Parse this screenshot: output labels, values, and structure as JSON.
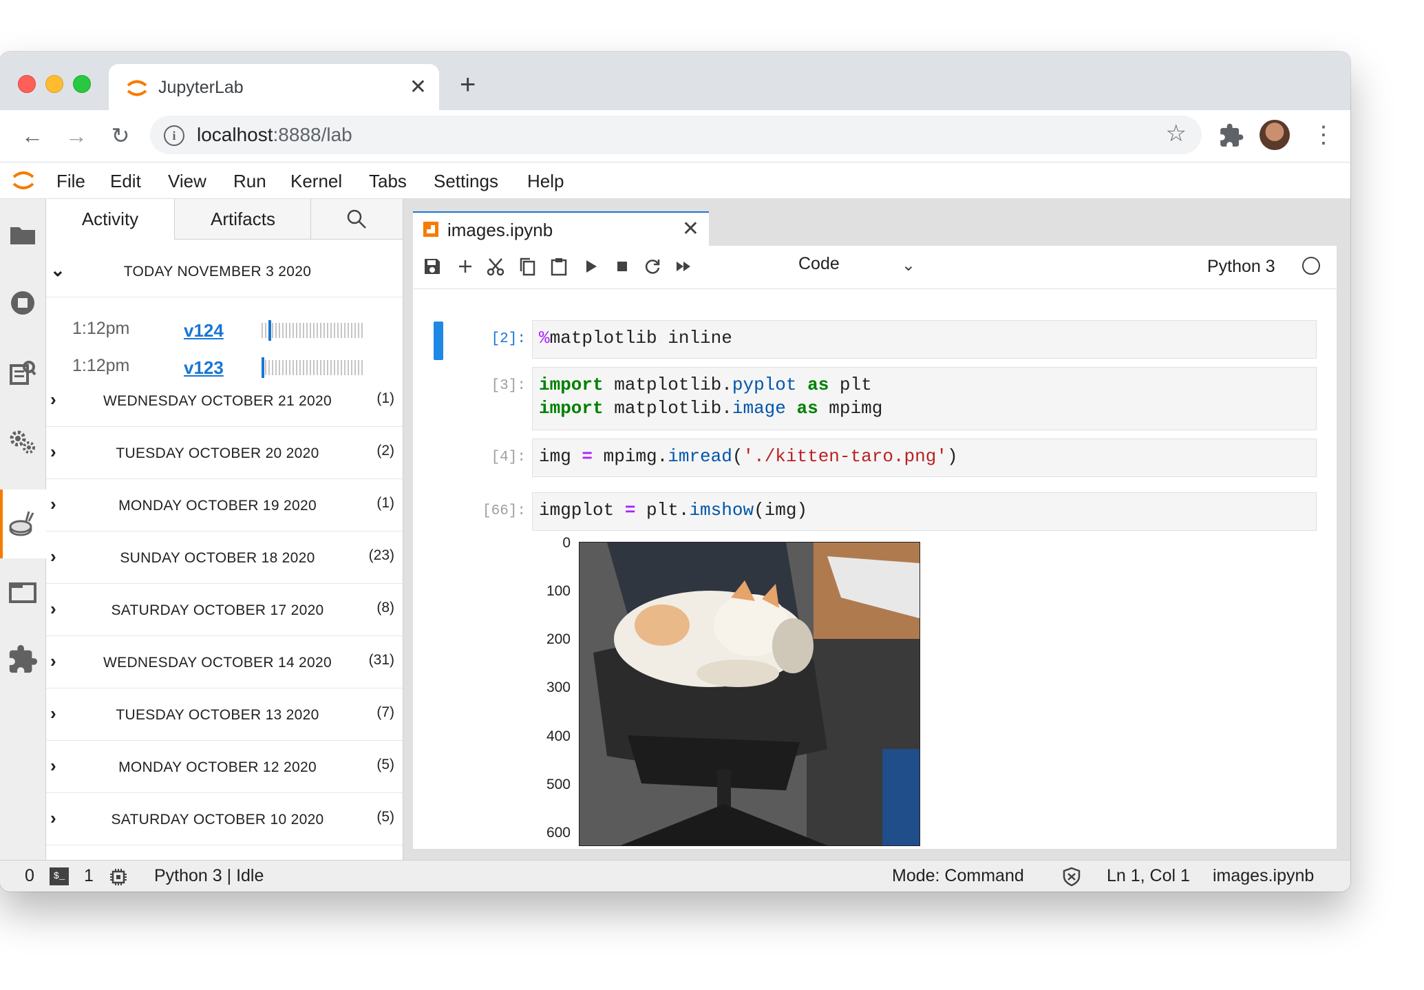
{
  "browser": {
    "tab_title": "JupyterLab",
    "url_host": "localhost",
    "url_rest": ":8888/lab"
  },
  "menu": [
    "File",
    "Edit",
    "View",
    "Run",
    "Kernel",
    "Tabs",
    "Settings",
    "Help"
  ],
  "panel": {
    "tabs": {
      "activity": "Activity",
      "artifacts": "Artifacts"
    },
    "today": {
      "label": "TODAY NOVEMBER 3 2020",
      "entries": [
        {
          "time": "1:12pm",
          "version": "v124"
        },
        {
          "time": "1:12pm",
          "version": "v123"
        }
      ]
    },
    "days": [
      {
        "label": "WEDNESDAY OCTOBER 21 2020",
        "count": "(1)"
      },
      {
        "label": "TUESDAY OCTOBER 20 2020",
        "count": "(2)"
      },
      {
        "label": "MONDAY OCTOBER 19 2020",
        "count": "(1)"
      },
      {
        "label": "SUNDAY OCTOBER 18 2020",
        "count": "(23)"
      },
      {
        "label": "SATURDAY OCTOBER 17 2020",
        "count": "(8)"
      },
      {
        "label": "WEDNESDAY OCTOBER 14 2020",
        "count": "(31)"
      },
      {
        "label": "TUESDAY OCTOBER 13 2020",
        "count": "(7)"
      },
      {
        "label": "MONDAY OCTOBER 12 2020",
        "count": "(5)"
      },
      {
        "label": "SATURDAY OCTOBER 10 2020",
        "count": "(5)"
      }
    ]
  },
  "notebook": {
    "tab_name": "images.ipynb",
    "cell_type": "Code",
    "kernel": "Python 3",
    "cells": [
      {
        "prompt": "[2]:"
      },
      {
        "prompt": "[3]:"
      },
      {
        "prompt": "[4]:"
      },
      {
        "prompt": "[66]:"
      }
    ],
    "code": {
      "c2": {
        "magic": "%",
        "rest": "matplotlib inline"
      },
      "c3": {
        "l1": {
          "kw1": "import",
          "a": " matplotlib.",
          "mod": "pyplot",
          "b": " ",
          "kw2": "as",
          "c": " plt"
        },
        "l2": {
          "kw1": "import",
          "a": " matplotlib.",
          "mod": "image",
          "b": " ",
          "kw2": "as",
          "c": " mpimg"
        }
      },
      "c4": {
        "a": "img ",
        "op": "=",
        "b": " mpimg.",
        "mod": "imread",
        "c": "(",
        "str": "'./kitten-taro.png'",
        "d": ")"
      },
      "c66": {
        "a": "imgplot ",
        "op": "=",
        "b": " plt.",
        "mod": "imshow",
        "c": "(img)"
      }
    },
    "output_yticks": [
      "0",
      "100",
      "200",
      "300",
      "400",
      "500",
      "600"
    ]
  },
  "status": {
    "terminals": "0",
    "kernels": "1",
    "kernel_status": "Python 3 | Idle",
    "mode": "Mode: Command",
    "position": "Ln 1, Col 1",
    "file": "images.ipynb"
  },
  "colors": {
    "accent_blue": "#1976d2",
    "jupyter_orange": "#f57c00"
  }
}
